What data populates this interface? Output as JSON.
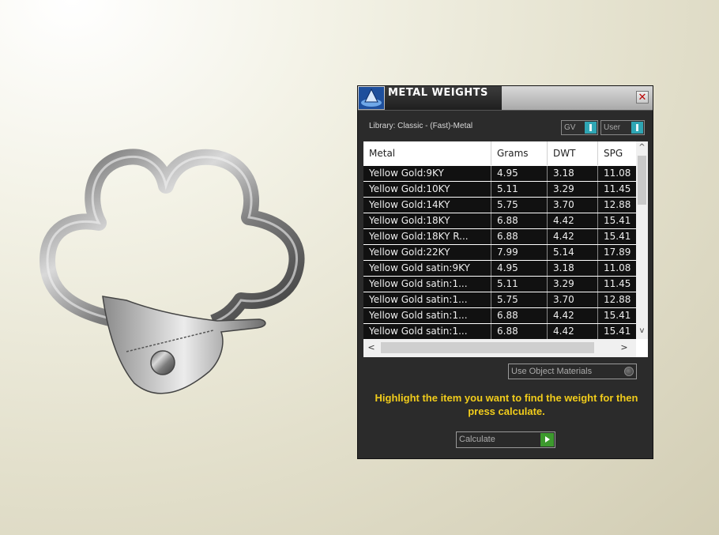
{
  "panel": {
    "title": "METAL WEIGHTS",
    "close_glyph": "✕",
    "library": "Library: Classic - (Fast)-Metal",
    "toggles": [
      {
        "label": "GV",
        "state": "on"
      },
      {
        "label": "User",
        "state": "on"
      }
    ],
    "table": {
      "columns": [
        "Metal",
        "Grams",
        "DWT",
        "SPG"
      ],
      "rows": [
        [
          "Yellow Gold:9KY",
          "4.95",
          "3.18",
          "11.08"
        ],
        [
          "Yellow Gold:10KY",
          "5.11",
          "3.29",
          "11.45"
        ],
        [
          "Yellow Gold:14KY",
          "5.75",
          "3.70",
          "12.88"
        ],
        [
          "Yellow Gold:18KY",
          "6.88",
          "4.42",
          "15.41"
        ],
        [
          "Yellow Gold:18KY R...",
          "6.88",
          "4.42",
          "15.41"
        ],
        [
          "Yellow Gold:22KY",
          "7.99",
          "5.14",
          "17.89"
        ],
        [
          "Yellow Gold satin:9KY",
          "4.95",
          "3.18",
          "11.08"
        ],
        [
          "Yellow Gold satin:1...",
          "5.11",
          "3.29",
          "11.45"
        ],
        [
          "Yellow Gold satin:1...",
          "5.75",
          "3.70",
          "12.88"
        ],
        [
          "Yellow Gold satin:1...",
          "6.88",
          "4.42",
          "15.41"
        ],
        [
          "Yellow Gold satin:1...",
          "6.88",
          "4.42",
          "15.41"
        ]
      ],
      "scroll_up": "^",
      "scroll_down": "v",
      "scroll_left": "<",
      "scroll_right": ">"
    },
    "use_object_materials": "Use Object Materials",
    "hint": "Highlight the item you want to find the weight for then press calculate.",
    "calculate_label": "Calculate"
  },
  "colors": {
    "hint": "#f1cc1b",
    "toggle_on": "#2fa6b4",
    "go_button": "#3d9a2e",
    "panel_bg": "#2b2b2b"
  },
  "icons": {
    "logo": "rhino-gold-logo-icon",
    "close": "close-icon",
    "calculate": "play-arrow-icon"
  }
}
